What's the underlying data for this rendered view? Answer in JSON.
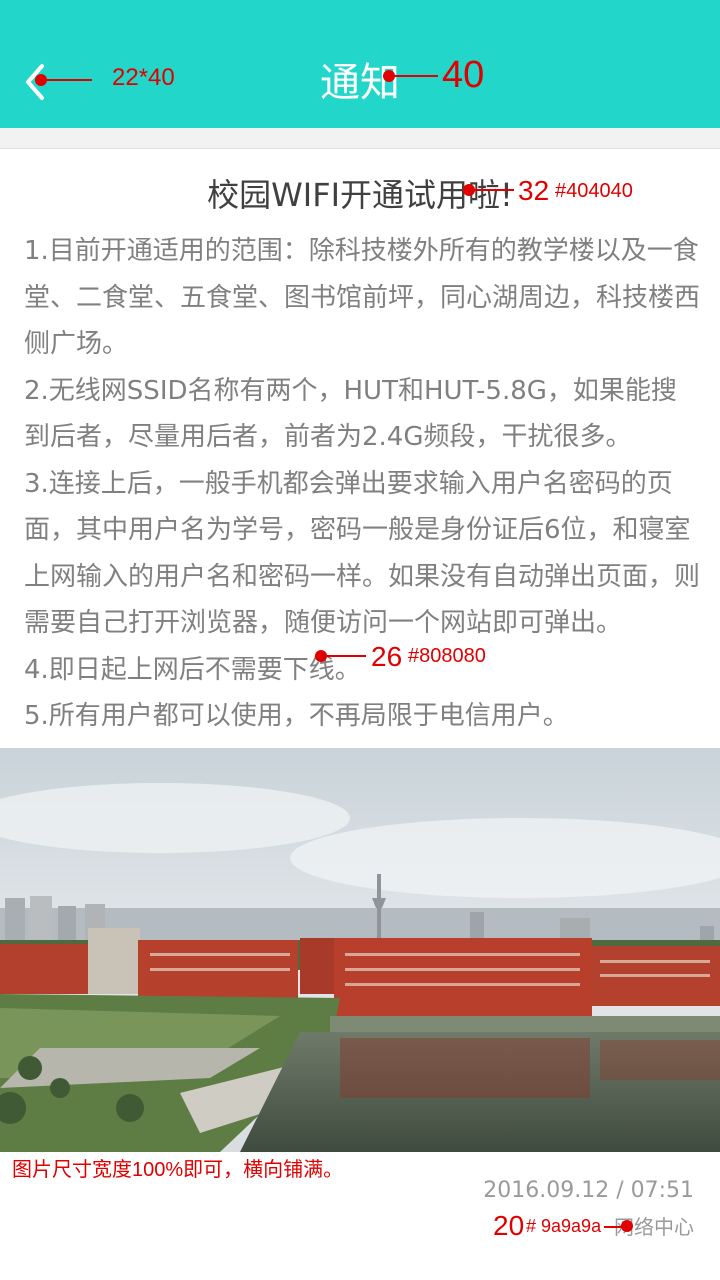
{
  "header": {
    "title": "通知"
  },
  "article": {
    "title": "校园WIFI开通试用啦!",
    "paragraphs": [
      "1.目前开通适用的范围：除科技楼外所有的教学楼以及一食堂、二食堂、五食堂、图书馆前坪，同心湖周边，科技楼西侧广场。",
      "2.无线网SSID名称有两个，HUT和HUT-5.8G，如果能搜到后者，尽量用后者，前者为2.4G频段，干扰很多。",
      "3.连接上后，一般手机都会弹出要求输入用户名密码的页面，其中用户名为学号，密码一般是身份证后6位，和寝室上网输入的用户名和密码一样。如果没有自动弹出页面，则需要自己打开浏览器，随便访问一个网站即可弹出。",
      "4.即日起上网后不需要下线。",
      "5.所有用户都可以使用，不再局限于电信用户。"
    ],
    "date": "2016.09.12 / 07:51",
    "source": "网络中心"
  },
  "annotations": {
    "back": "22*40",
    "header_size": "40",
    "title_size": "32",
    "title_color": "#404040",
    "body_size": "26",
    "body_color": "#808080",
    "image_note": "图片尺寸宽度100%即可，横向铺满。",
    "footer_size": "20",
    "footer_color": "# 9a9a9a"
  },
  "colors": {
    "header_bg": "#22d6c9",
    "annotation": "#e00000"
  },
  "icons": {
    "back": "chevron-left-icon"
  }
}
